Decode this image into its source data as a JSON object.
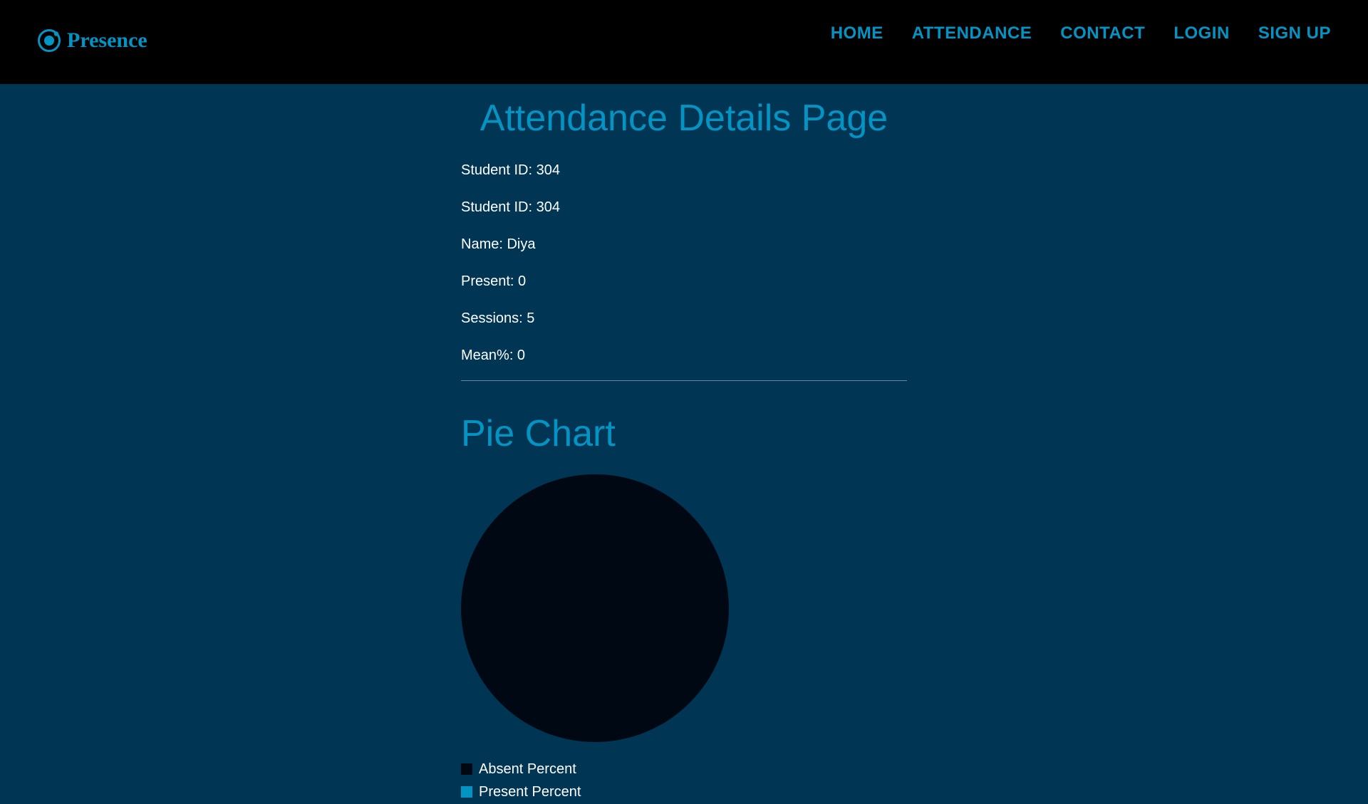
{
  "navbar": {
    "brand": "Presence",
    "links": [
      {
        "label": "HOME"
      },
      {
        "label": "ATTENDANCE"
      },
      {
        "label": "CONTACT"
      },
      {
        "label": "LOGIN"
      },
      {
        "label": "SIGN UP"
      }
    ]
  },
  "page_title": "Attendance Details Page",
  "details": [
    "Student ID: 304",
    "Student ID: 304",
    "Name: Diya",
    "Present: 0",
    "Sessions: 5",
    "Mean%: 0"
  ],
  "chart_data": {
    "type": "pie",
    "title": "Pie Chart",
    "categories": [
      "Absent Percent",
      "Present Percent"
    ],
    "values": [
      100,
      0
    ],
    "colors": [
      "#000814",
      "#0494c4"
    ],
    "legend_position": "bottom-left"
  },
  "colors": {
    "background": "#003554",
    "navbar": "#000000",
    "accent": "#0494c4",
    "text": "#ffffff"
  },
  "icons": {
    "brand": "ionic-logo-icon"
  }
}
